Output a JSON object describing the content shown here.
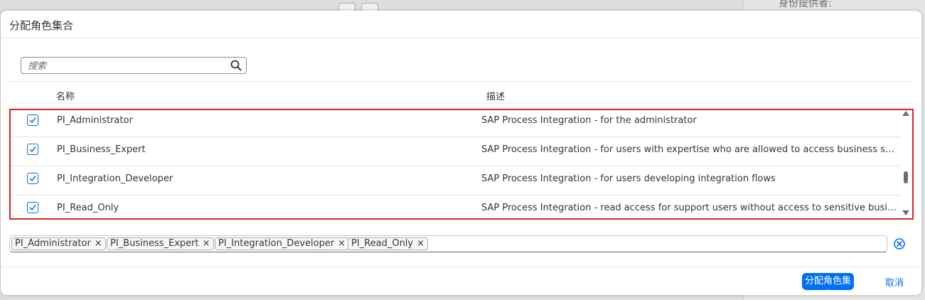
{
  "background": {
    "right_panel_text": "身份提供者:"
  },
  "dialog": {
    "title": "分配角色集合",
    "search": {
      "placeholder": "搜索",
      "value": ""
    },
    "table": {
      "columns": [
        "名称",
        "描述"
      ],
      "rows": [
        {
          "checked": true,
          "name": "PI_Administrator",
          "description": "SAP Process Integration - for the administrator"
        },
        {
          "checked": true,
          "name": "PI_Business_Expert",
          "description": "SAP Process Integration - for users with expertise who are allowed to access business sensit..."
        },
        {
          "checked": true,
          "name": "PI_Integration_Developer",
          "description": "SAP Process Integration - for users developing integration flows"
        },
        {
          "checked": true,
          "name": "PI_Read_Only",
          "description": "SAP Process Integration - read access for support users without access to sensitive business..."
        }
      ]
    },
    "tokens": [
      "PI_Administrator",
      "PI_Business_Expert",
      "PI_Integration_Developer",
      "PI_Read_Only"
    ],
    "token_close_glyph": "×",
    "footer": {
      "primary_label": "分配角色集合",
      "cancel_label": "取消"
    }
  },
  "colors": {
    "accent": "#0070f2",
    "highlight": "#d9262b",
    "checkbox": "#0a6ed1"
  }
}
